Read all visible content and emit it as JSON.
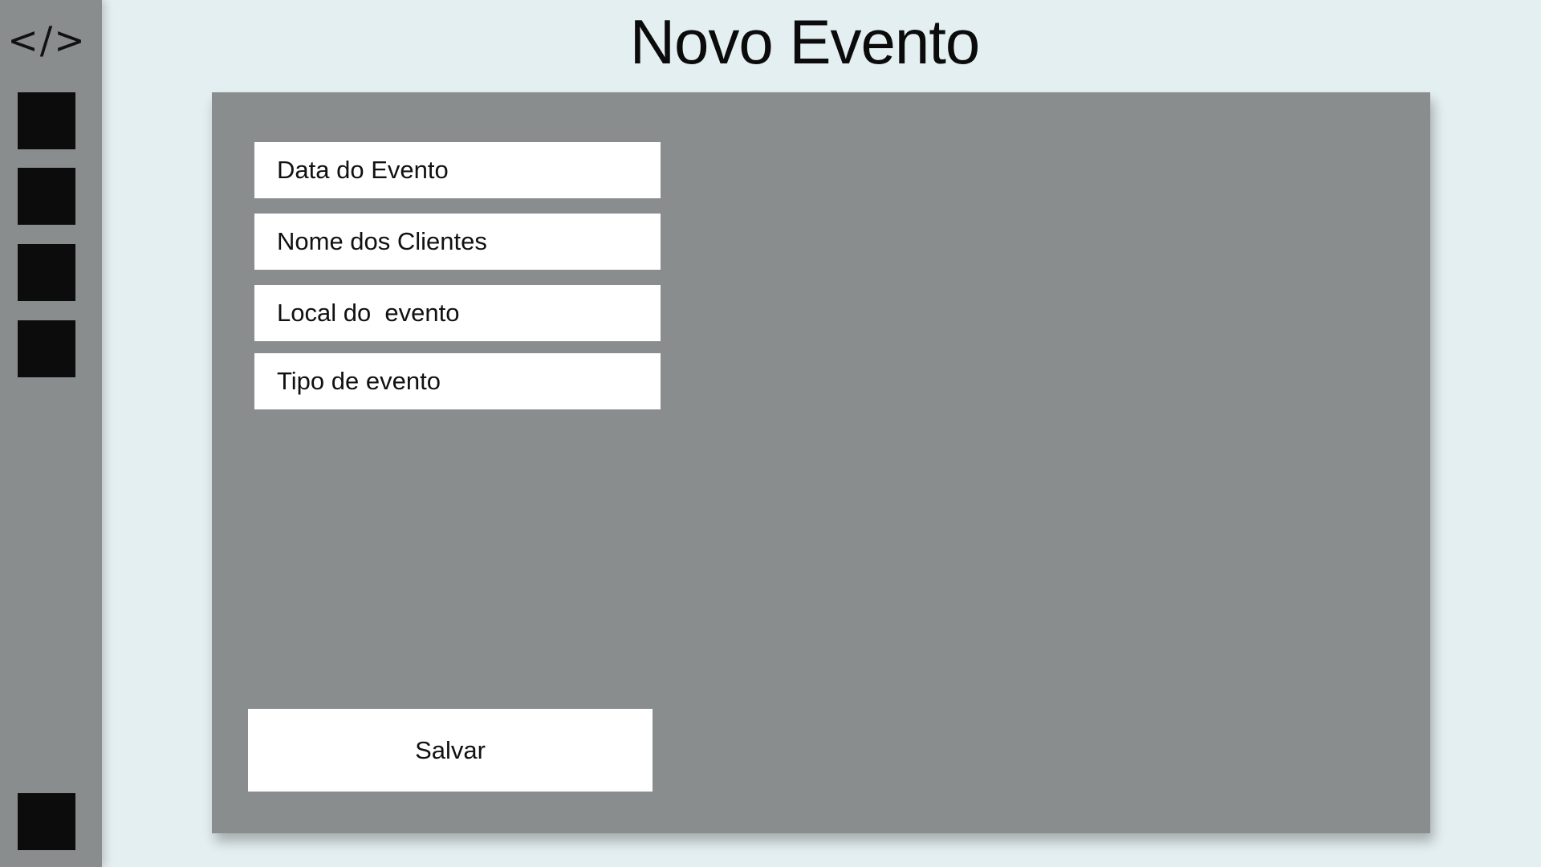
{
  "sidebar": {
    "logo": "</>",
    "logo_icon": "code-icon",
    "items": [
      {
        "icon": "nav-square-icon"
      },
      {
        "icon": "nav-square-icon"
      },
      {
        "icon": "nav-square-icon"
      },
      {
        "icon": "nav-square-icon"
      }
    ],
    "bottom_item": {
      "icon": "nav-square-icon"
    }
  },
  "header": {
    "title": "Novo Evento"
  },
  "form": {
    "fields": [
      {
        "placeholder": "Data do Evento",
        "value": ""
      },
      {
        "placeholder": "Nome dos Clientes",
        "value": ""
      },
      {
        "placeholder": "Local do  evento",
        "value": ""
      },
      {
        "placeholder": "Tipo de evento",
        "value": ""
      }
    ],
    "save_label": "Salvar"
  },
  "colors": {
    "background": "#e4eff1",
    "sidebar": "#8a8d8d",
    "panel": "#8a8d8d",
    "nav_item": "#0c0c0c",
    "field": "#ffffff",
    "text": "#111111"
  }
}
